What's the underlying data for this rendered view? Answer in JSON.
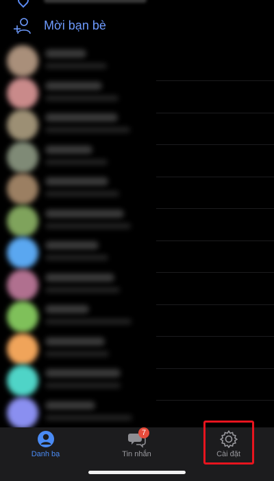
{
  "invite": {
    "label": "Mời bạn bè",
    "icon": "add-person-icon"
  },
  "contacts": [
    {
      "avatar_color": "#a98f7a"
    },
    {
      "avatar_color": "#c98a8a"
    },
    {
      "avatar_color": "#9c8f74"
    },
    {
      "avatar_color": "#7f8a76"
    },
    {
      "avatar_color": "#9b7f62"
    },
    {
      "avatar_color": "#7fa35c"
    },
    {
      "avatar_color": "#5aa7f0"
    },
    {
      "avatar_color": "#b0708f"
    },
    {
      "avatar_color": "#7fc05a"
    },
    {
      "avatar_color": "#f0a45a"
    },
    {
      "avatar_color": "#4fd4c7"
    },
    {
      "avatar_color": "#8a8ff0"
    }
  ],
  "tabs": {
    "contacts": {
      "label": "Danh bạ",
      "icon": "person-circle-icon",
      "active": true
    },
    "messages": {
      "label": "Tin nhắn",
      "icon": "chat-bubbles-icon",
      "badge": "7"
    },
    "settings": {
      "label": "Cài đặt",
      "icon": "gear-icon"
    }
  },
  "colors": {
    "accent": "#4a8bf5",
    "badge": "#e74c3c",
    "highlight": "#e8141e",
    "tabbar_bg": "#1c1c1e"
  }
}
